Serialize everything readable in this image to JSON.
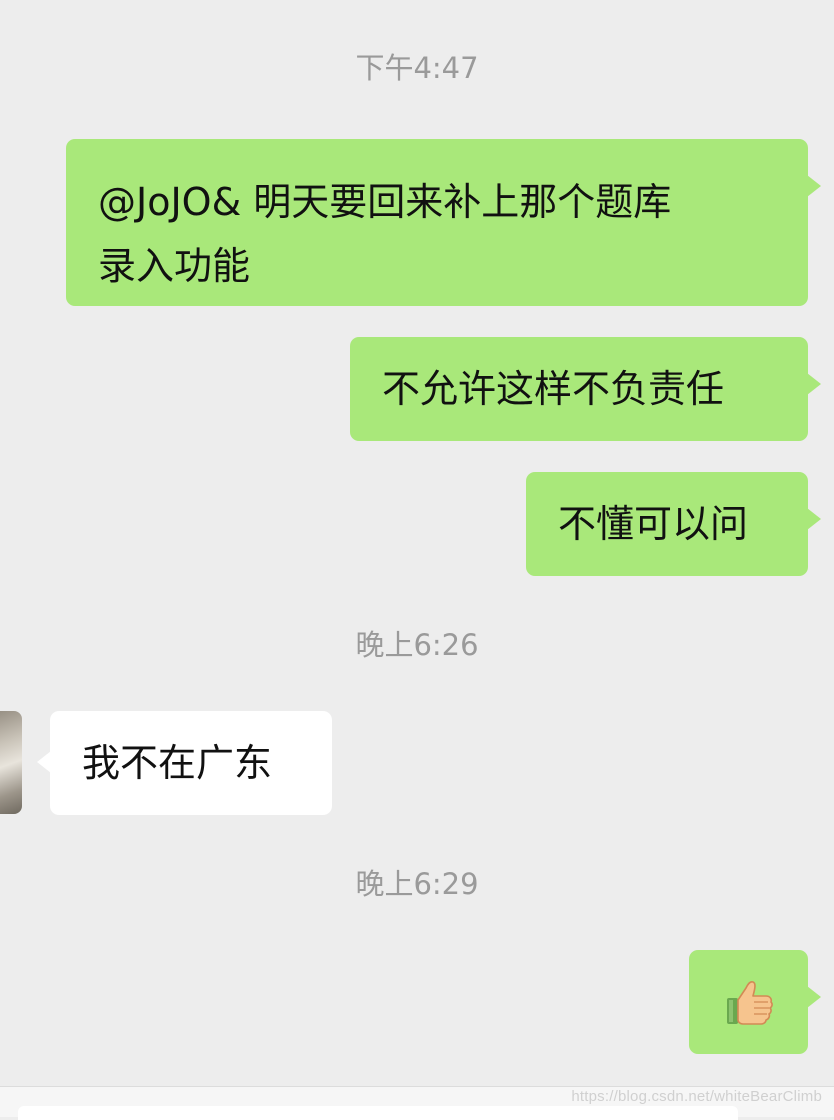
{
  "timestamps": [
    "下午4:47",
    "晚上6:26",
    "晚上6:29"
  ],
  "messages": [
    {
      "sender": "me",
      "lines": [
        "@JoJO& 明天要回来补上那个题库",
        "录入功能"
      ]
    },
    {
      "sender": "me",
      "text": "不允许这样不负责任"
    },
    {
      "sender": "me",
      "text": "不懂可以问"
    },
    {
      "sender": "other",
      "text": "我不在广东"
    },
    {
      "sender": "me",
      "emoji": "thumbs-up"
    }
  ],
  "watermark": "https://blog.csdn.net/whiteBearClimb",
  "colors": {
    "background": "#ededed",
    "my_bubble": "#a9e87a",
    "their_bubble": "#ffffff",
    "timestamp_text": "#9a9a9a"
  }
}
